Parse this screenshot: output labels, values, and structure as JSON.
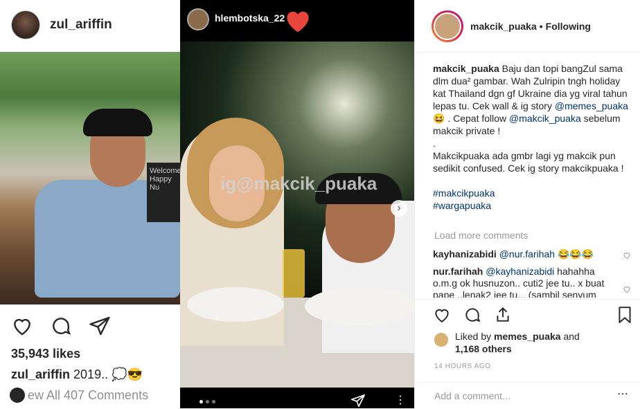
{
  "left_post": {
    "username": "zul_ariffin",
    "sign_text": "Welcome Happy Nu",
    "likes": "35,943 likes",
    "caption_user": "zul_ariffin",
    "caption_text": "2019.. 💭😎",
    "view_comments": "ew All 407 Comments"
  },
  "story": {
    "username": "hlembotska_22",
    "watermark": "ig@makcik_puaka",
    "pager_dots": 3,
    "current_dot": 1
  },
  "right_panel": {
    "username": "makcik_puaka",
    "follow_status": "Following",
    "caption": {
      "user": "makcik_puaka",
      "text1": " Baju dan topi bangZul sama dlm dua² gambar. Wah Zulripin tngh holiday kat Thailand dgn gf Ukraine dia yg viral tahun lepas tu. Cek wall & ig story ",
      "mention1": "@memes_puaka",
      "text2": " 😆 . Cepat follow ",
      "mention2": "@makcik_puaka",
      "text3": " sebelum makcik private !",
      "dot": ".",
      "para2": "Makcikpuaka ada gmbr lagi yg makcik pun sedikit confused. Cek ig story makcikpuaka !",
      "hashtag1": "#makcikpuaka",
      "hashtag2": "#wargapuaka"
    },
    "load_more": "Load more comments",
    "comments": [
      {
        "user": "kayhanizabidi",
        "mention": "@nur.farihah",
        "text": " 😂😂😂"
      },
      {
        "user": "nur.farihah",
        "mention": "@kayhanizabidi",
        "text": " hahahha o.m.g ok husnuzon.. cuti2 jee tu.. x buat pape ..lenak2 jee tu... (sambil senyum"
      }
    ],
    "liked_by": "Liked by",
    "liked_user": "memes_puaka",
    "liked_and": "and",
    "liked_others": "1,168 others",
    "timestamp": "14 HOURS AGO",
    "comment_placeholder": "Add a comment..."
  }
}
